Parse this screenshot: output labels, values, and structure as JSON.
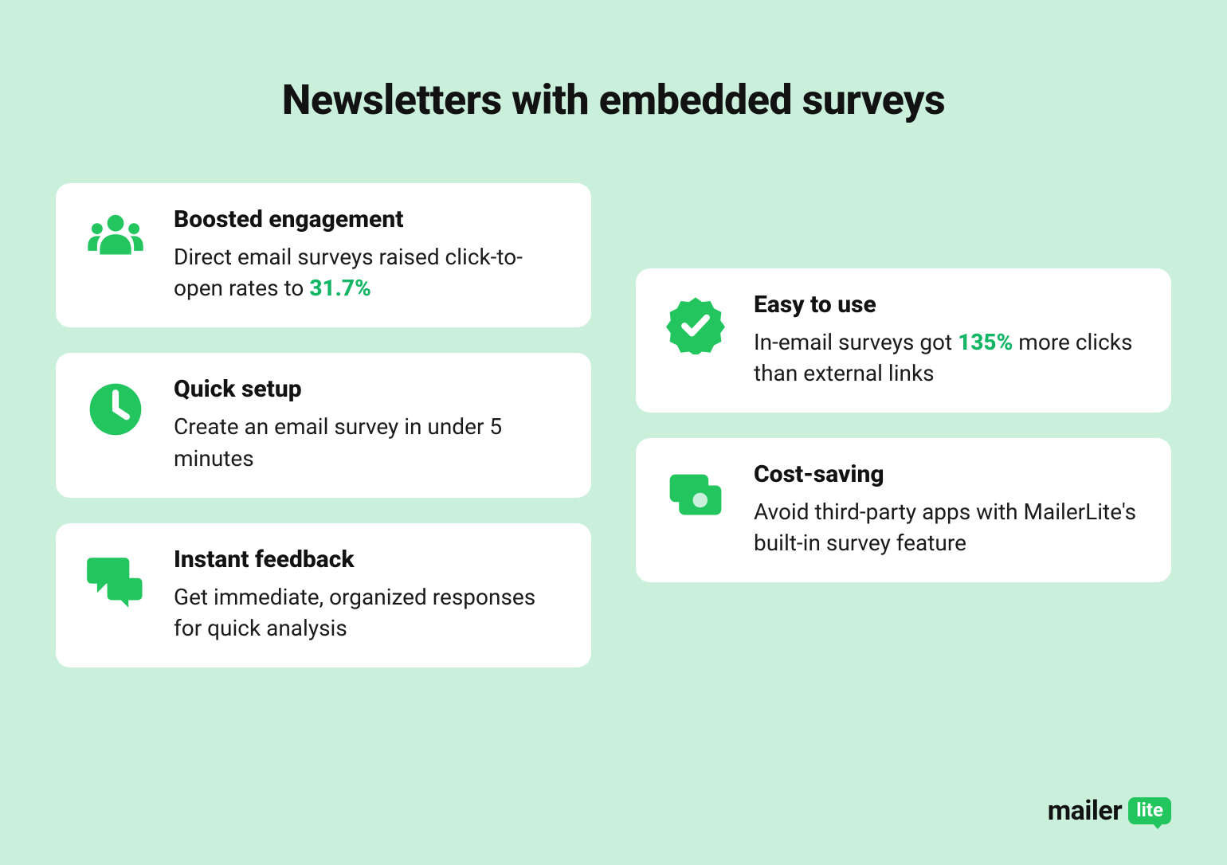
{
  "title": "Newsletters with embedded surveys",
  "colors": {
    "accent": "#22c55e",
    "bg": "#caf0dc",
    "card": "#ffffff"
  },
  "cards": {
    "left": [
      {
        "icon": "people-icon",
        "title": "Boosted engagement",
        "desc_pre": "Direct email surveys raised click-to-open rates to ",
        "highlight": "31.7%",
        "desc_post": ""
      },
      {
        "icon": "clock-icon",
        "title": "Quick setup",
        "desc_pre": "Create an email survey in under 5 minutes",
        "highlight": "",
        "desc_post": ""
      },
      {
        "icon": "chat-icon",
        "title": "Instant feedback",
        "desc_pre": "Get immediate, organized responses for quick analysis",
        "highlight": "",
        "desc_post": ""
      }
    ],
    "right": [
      {
        "icon": "badge-check-icon",
        "title": "Easy to use",
        "desc_pre": "In-email surveys got ",
        "highlight": "135%",
        "desc_post": " more clicks than external links"
      },
      {
        "icon": "money-icon",
        "title": "Cost-saving",
        "desc_pre": "Avoid third-party apps with MailerLite's built-in survey feature",
        "highlight": "",
        "desc_post": ""
      }
    ]
  },
  "brand": {
    "name": "mailer",
    "suffix": "lite"
  }
}
